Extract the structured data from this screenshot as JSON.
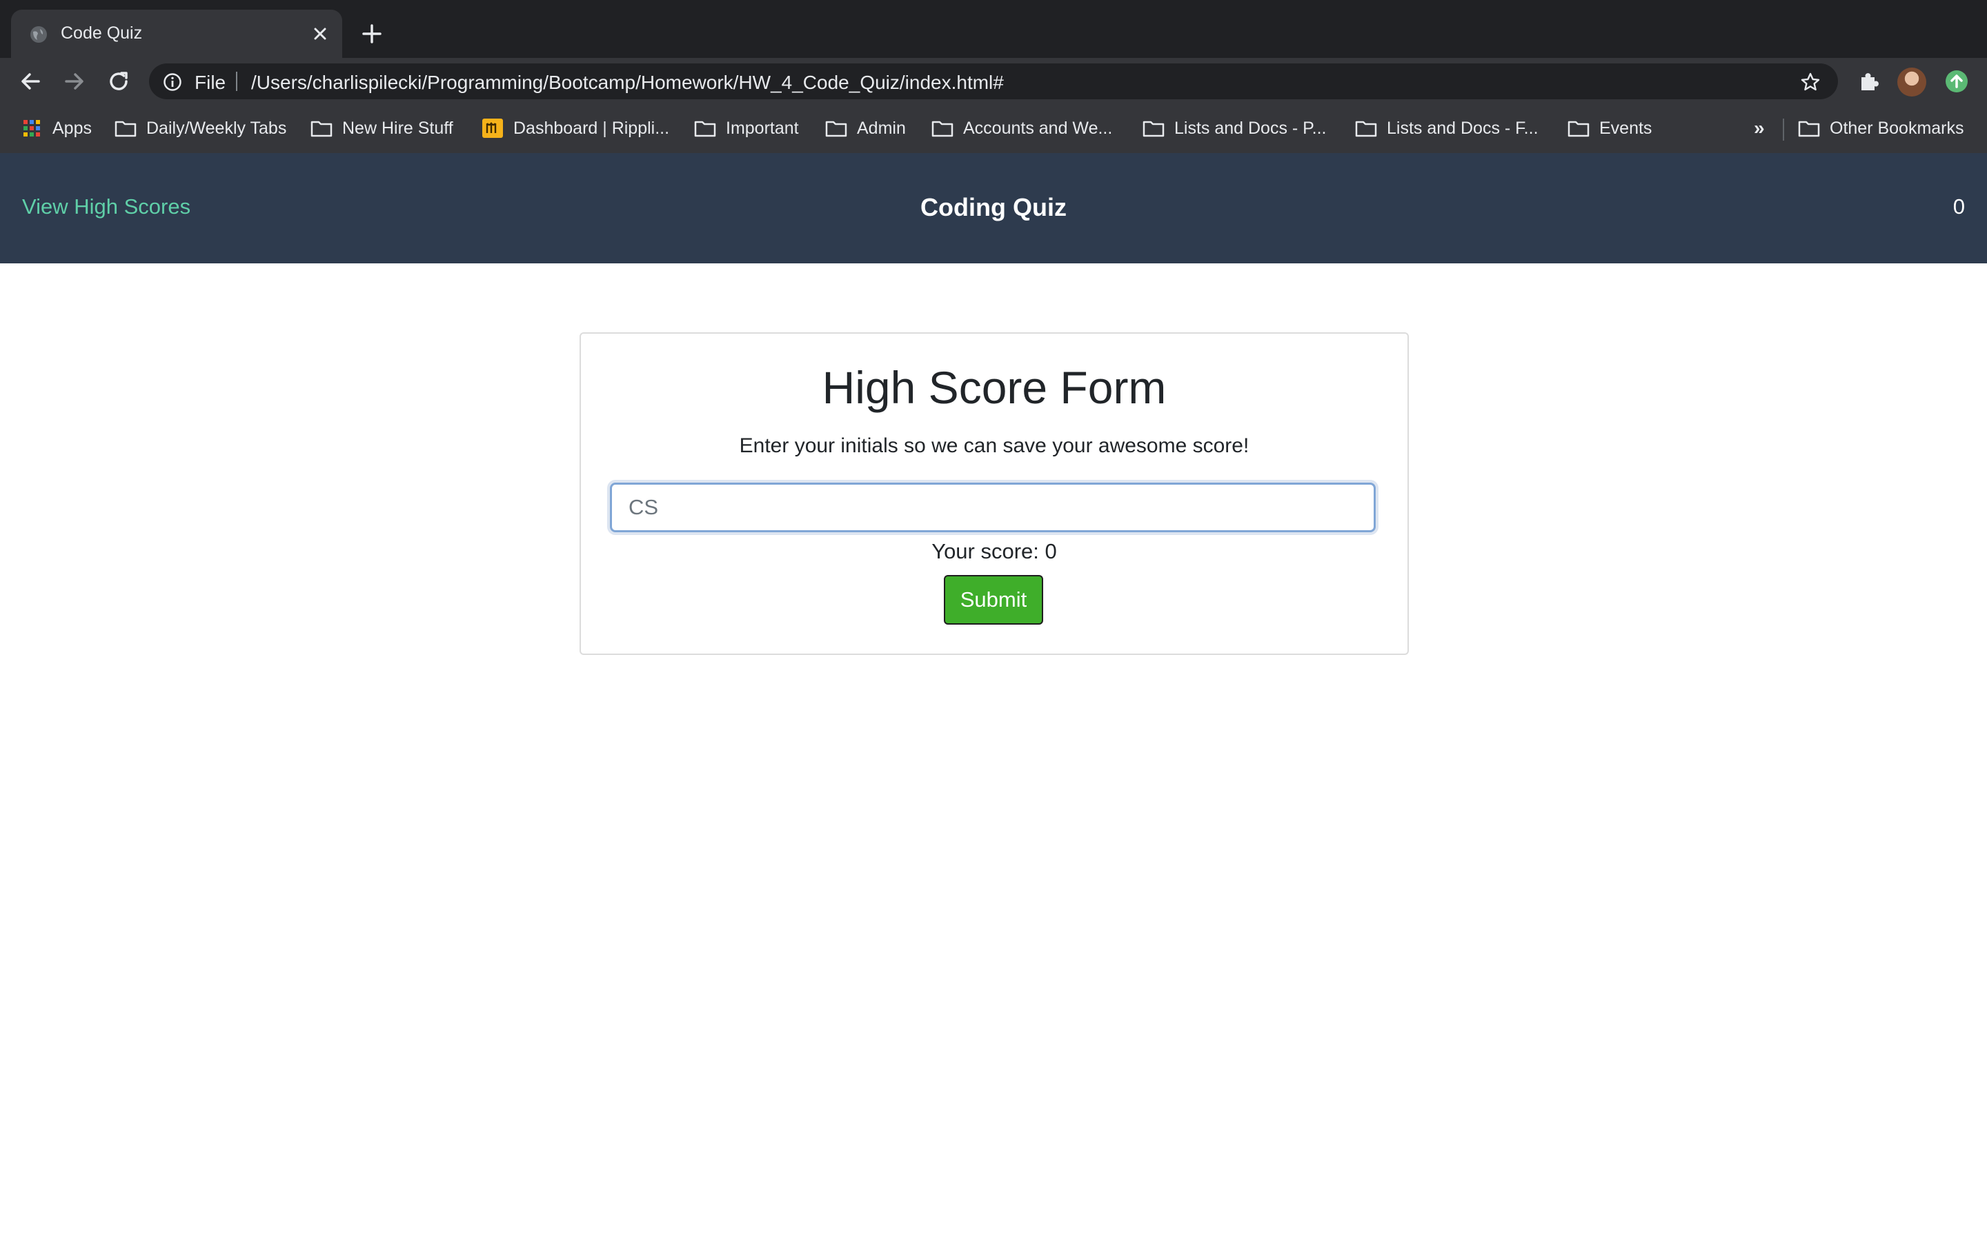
{
  "browser": {
    "tab": {
      "title": "Code Quiz"
    },
    "toolbar": {
      "scheme_label": "File",
      "url": "/Users/charlispilecki/Programming/Bootcamp/Homework/HW_4_Code_Quiz/index.html#"
    },
    "bookmarks": [
      {
        "label": "Apps",
        "icon": "apps-grid-icon"
      },
      {
        "label": "Daily/Weekly Tabs",
        "icon": "folder-icon"
      },
      {
        "label": "New Hire Stuff",
        "icon": "folder-icon"
      },
      {
        "label": "Dashboard | Rippli...",
        "icon": "rippling-icon"
      },
      {
        "label": "Important",
        "icon": "folder-icon"
      },
      {
        "label": "Admin",
        "icon": "folder-icon"
      },
      {
        "label": "Accounts and We...",
        "icon": "folder-icon"
      },
      {
        "label": "Lists and Docs - P...",
        "icon": "folder-icon"
      },
      {
        "label": "Lists and Docs - F...",
        "icon": "folder-icon"
      },
      {
        "label": "Events",
        "icon": "folder-icon"
      }
    ],
    "more_bookmarks": "»",
    "other_bookmarks": "Other Bookmarks"
  },
  "page": {
    "header": {
      "view_high_scores": "View High Scores",
      "title": "Coding Quiz",
      "timer": "0"
    },
    "form": {
      "title": "High Score Form",
      "instructions": "Enter your initials so we can save your awesome score!",
      "initials_value": "CS",
      "score_label": "Your score: 0",
      "submit_label": "Submit"
    }
  },
  "colors": {
    "header_bg": "#2e3b4e",
    "link": "#5fcfa8",
    "submit_bg": "#3fae2a",
    "chrome_dark": "#202124",
    "chrome_toolbar": "#35363a"
  }
}
